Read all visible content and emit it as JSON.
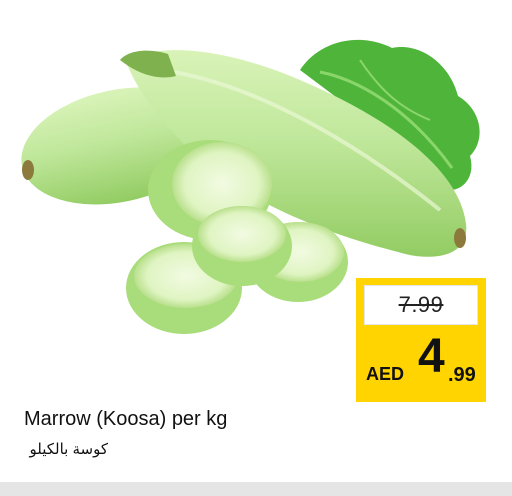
{
  "product": {
    "name_en": "Marrow (Koosa) per kg",
    "name_ar": "كوسة بالكيلو",
    "image_subject": "zucchini-with-lettuce-leaf"
  },
  "price": {
    "old": "7.99",
    "currency": "AED",
    "new_integer": "4",
    "new_decimal": ".99"
  },
  "colors": {
    "badge_yellow": "#ffd400",
    "zucchini_light": "#c7ec9c",
    "zucchini_dark": "#86c25a",
    "lettuce": "#49b035",
    "text": "#111111"
  }
}
